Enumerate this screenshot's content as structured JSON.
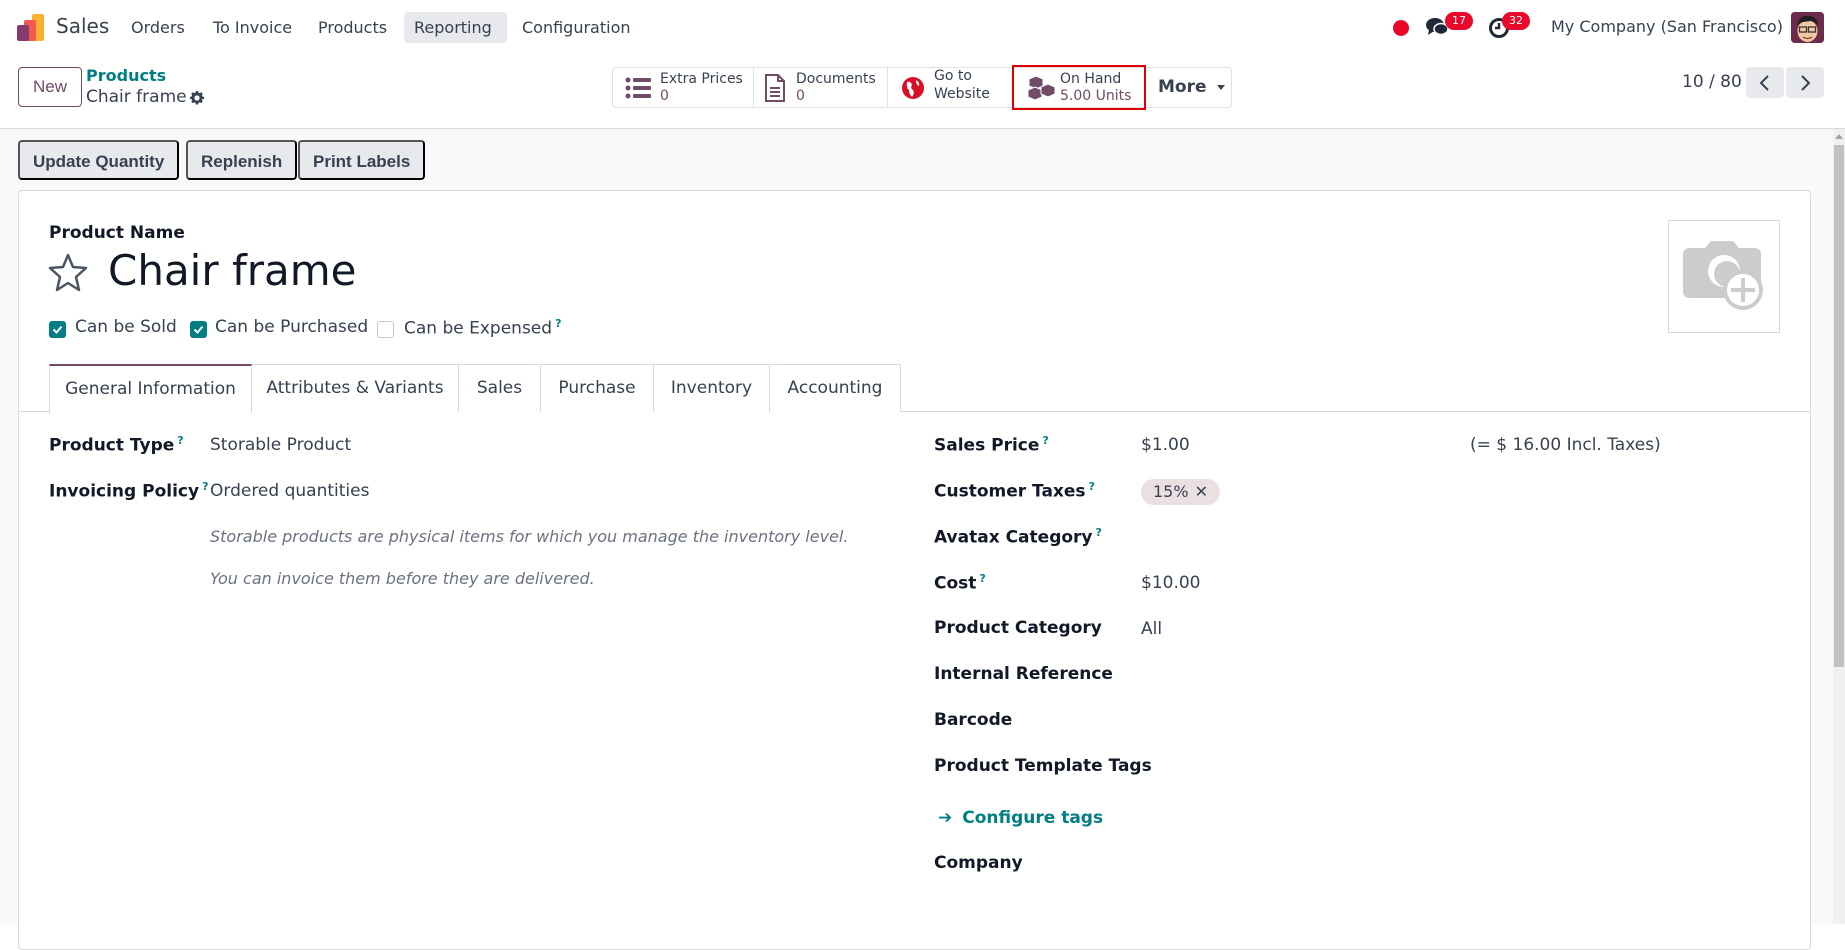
{
  "navbar": {
    "app_name": "Sales",
    "menu": [
      {
        "label": "Orders"
      },
      {
        "label": "To Invoice"
      },
      {
        "label": "Products"
      },
      {
        "label": "Reporting",
        "active": true
      },
      {
        "label": "Configuration"
      }
    ],
    "messages_count": "17",
    "activities_count": "32",
    "company": "My Company (San Francisco)"
  },
  "control_panel": {
    "new_label": "New",
    "breadcrumb_parent": "Products",
    "breadcrumb_current": "Chair frame",
    "smart_buttons": [
      {
        "icon": "list-icon",
        "line1": "Extra Prices",
        "line2": "0"
      },
      {
        "icon": "document-icon",
        "line1": "Documents",
        "line2": "0"
      },
      {
        "icon": "globe-icon",
        "line1": "Go to",
        "line2": "Website"
      },
      {
        "icon": "cubes-icon",
        "line1": "On Hand",
        "line2": "5.00 Units"
      }
    ],
    "more_label": "More",
    "pager": "10 / 80"
  },
  "actions": {
    "update_quantity": "Update Quantity",
    "replenish": "Replenish",
    "print_labels": "Print Labels"
  },
  "form": {
    "product_name_label": "Product Name",
    "product_name": "Chair frame",
    "checkboxes": [
      {
        "label": "Can be Sold",
        "checked": true
      },
      {
        "label": "Can be Purchased",
        "checked": true
      },
      {
        "label": "Can be Expensed",
        "checked": false,
        "help": "?"
      }
    ],
    "tabs": [
      {
        "label": "General Information",
        "active": true
      },
      {
        "label": "Attributes & Variants"
      },
      {
        "label": "Sales"
      },
      {
        "label": "Purchase"
      },
      {
        "label": "Inventory"
      },
      {
        "label": "Accounting"
      }
    ],
    "left_fields": {
      "product_type_label": "Product Type",
      "product_type": "Storable Product",
      "invoicing_policy_label": "Invoicing Policy",
      "invoicing_policy": "Ordered quantities",
      "note1": "Storable products are physical items for which you manage the inventory level.",
      "note2": "You can invoice them before they are delivered."
    },
    "right_fields": {
      "sales_price_label": "Sales Price",
      "sales_price": "$1.00",
      "incl_taxes": "(= $ 16.00 Incl. Taxes)",
      "customer_taxes_label": "Customer Taxes",
      "customer_tax_tag": "15%",
      "avatax_category_label": "Avatax Category",
      "cost_label": "Cost",
      "cost": "$10.00",
      "product_category_label": "Product Category",
      "product_category": "All",
      "internal_reference_label": "Internal Reference",
      "barcode_label": "Barcode",
      "product_template_tags_label": "Product Template Tags",
      "configure_tags_link": "Configure tags",
      "company_label": "Company"
    },
    "help_mark": "?"
  },
  "colors": {
    "brand": "#714b67",
    "accent": "#017e84",
    "badge": "#e9082a",
    "highlight_box": "#e00000"
  }
}
